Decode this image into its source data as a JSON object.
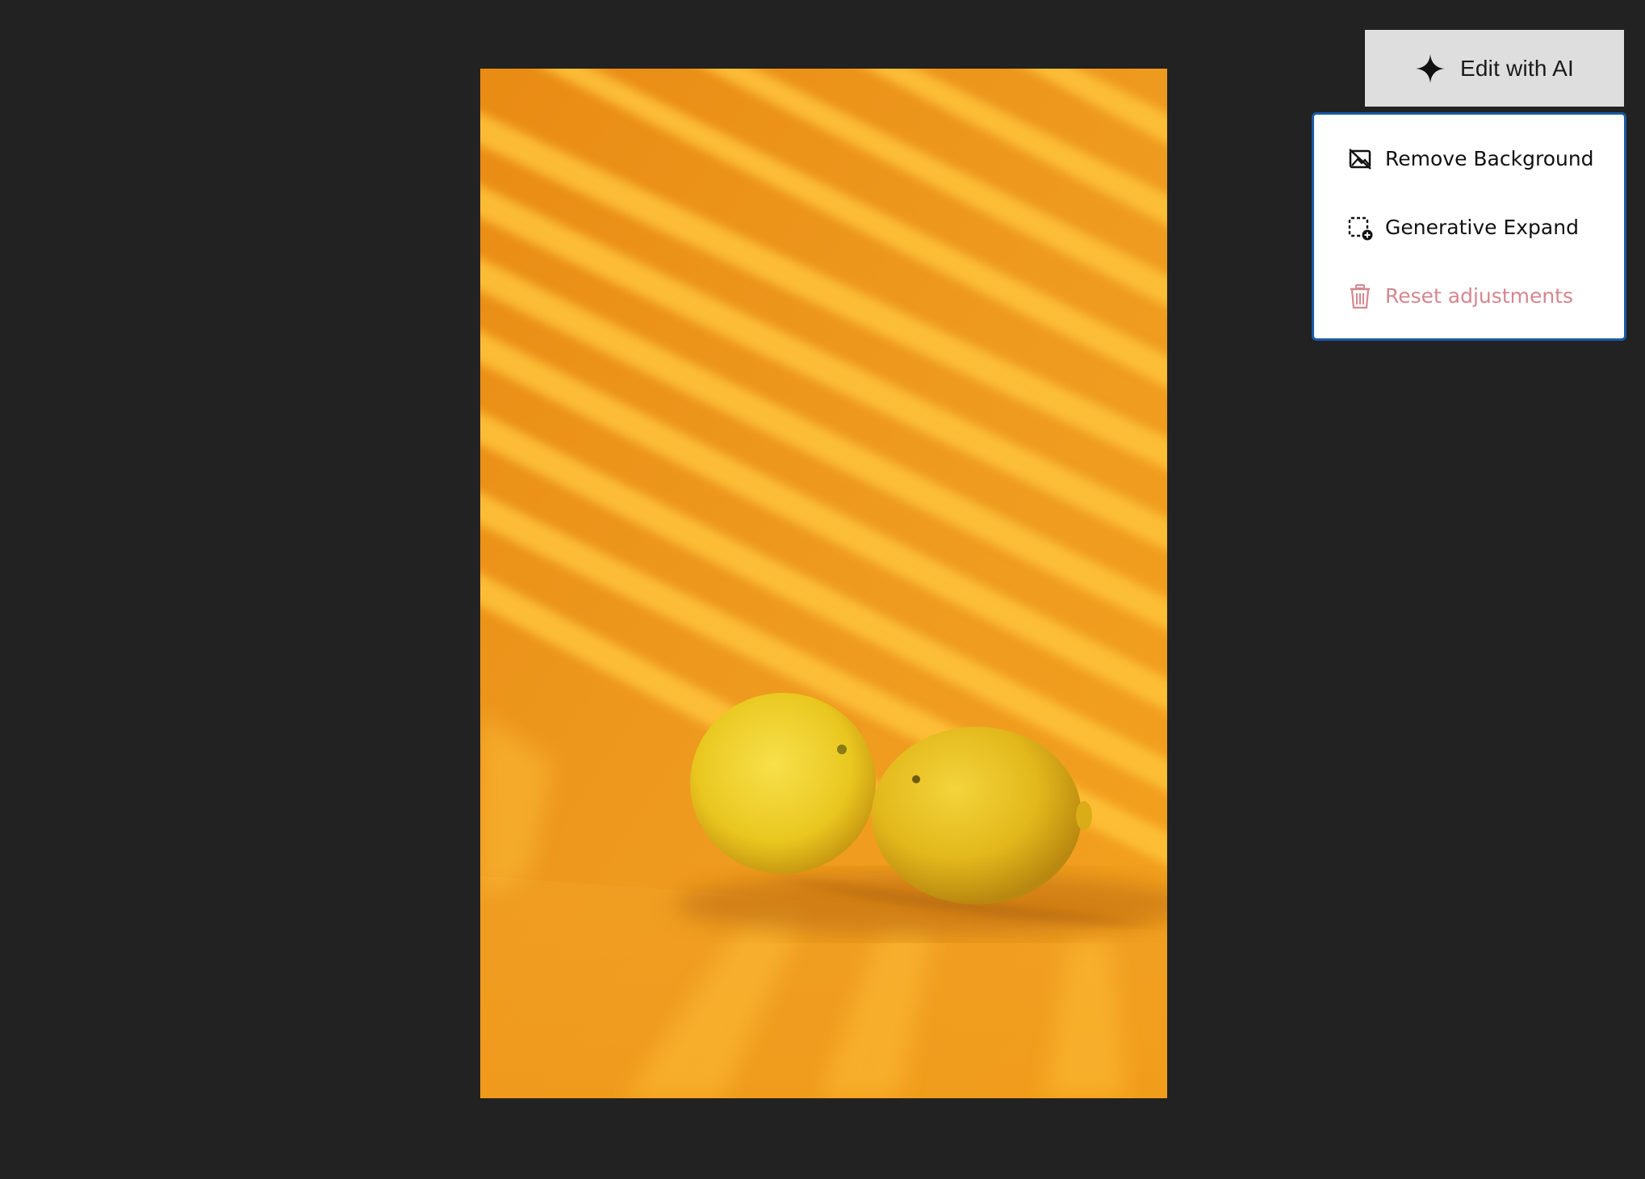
{
  "editor": {
    "ai_button": {
      "label": "Edit with AI",
      "icon": "sparkle-icon"
    },
    "ai_menu": {
      "items": [
        {
          "label": "Remove Background",
          "icon": "remove-background-icon"
        },
        {
          "label": "Generative Expand",
          "icon": "generative-expand-icon"
        },
        {
          "label": "Reset adjustments",
          "icon": "trash-icon",
          "color": "#d4878f"
        }
      ],
      "border_color": "#1b5aa6"
    },
    "canvas": {
      "background": "#222222",
      "image_subject": "two lemons on orange background with diagonal light stripes"
    }
  }
}
